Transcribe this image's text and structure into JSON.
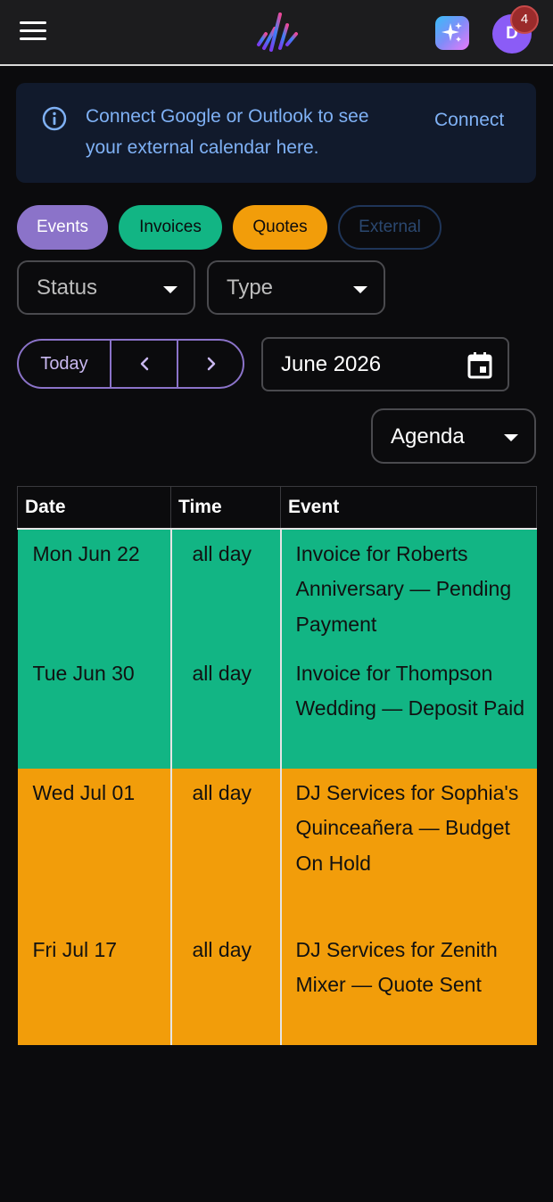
{
  "header": {
    "menu_icon": "hamburger-menu-icon",
    "logo_icon": "app-logo-icon",
    "assistant_icon": "sparkle-icon",
    "avatar_initial": "D",
    "notification_count": "4"
  },
  "banner": {
    "icon": "info-icon",
    "message": "Connect Google or Outlook to see your external calendar here.",
    "action_label": "Connect"
  },
  "filters": {
    "chips": [
      {
        "label": "Events",
        "color": "#8b73c9"
      },
      {
        "label": "Invoices",
        "color": "#12b584"
      },
      {
        "label": "Quotes",
        "color": "#f29d0a"
      },
      {
        "label": "External",
        "color": "#1f3558"
      }
    ],
    "status_label": "Status",
    "type_label": "Type"
  },
  "navigation": {
    "today_label": "Today",
    "prev_icon": "chevron-left-icon",
    "next_icon": "chevron-right-icon",
    "month_value": "June 2026",
    "calendar_icon": "calendar-icon",
    "view_label": "Agenda"
  },
  "agenda": {
    "columns": [
      "Date",
      "Time",
      "Event"
    ],
    "rows": [
      {
        "date": "Mon Jun 22",
        "time": "all day",
        "event": "Invoice for Roberts Anniversary — Pending Payment",
        "kind": "invoice"
      },
      {
        "date": "Tue Jun 30",
        "time": "all day",
        "event": "Invoice for Thompson Wedding — Deposit Paid",
        "kind": "invoice"
      },
      {
        "date": "Wed Jul 01",
        "time": "all day",
        "event": "DJ Services for Sophia's Quinceañera — Budget On Hold",
        "kind": "quote"
      },
      {
        "date": "Fri Jul 17",
        "time": "all day",
        "event": "DJ Services for Zenith Mixer — Quote Sent",
        "kind": "quote"
      }
    ]
  }
}
